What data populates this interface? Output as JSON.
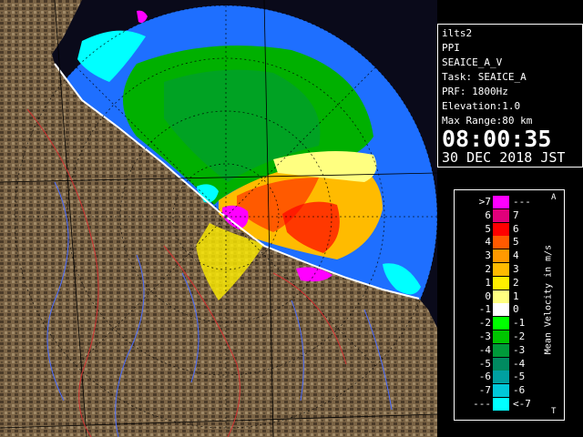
{
  "info": {
    "station": "ilts2",
    "product": "PPI",
    "product_name": "SEAICE_A_V",
    "task": "Task: SEAICE_A",
    "prf": "PRF: 1800Hz",
    "elevation": "Elevation:1.0",
    "max_range": "Max Range:80 km",
    "time": "08:00:35",
    "date": "30 DEC 2018 JST"
  },
  "legend": {
    "title": "Mean Velocity in m/s",
    "corner_top": "A",
    "corner_bottom": "T",
    "rows": [
      {
        "left": ">7",
        "right": "---",
        "color": "#ff00ff"
      },
      {
        "left": "6",
        "right": "7",
        "color": "#e0007a"
      },
      {
        "left": "5",
        "right": "6",
        "color": "#ff0000"
      },
      {
        "left": "4",
        "right": "5",
        "color": "#ff5a00"
      },
      {
        "left": "3",
        "right": "4",
        "color": "#ff9900"
      },
      {
        "left": "2",
        "right": "3",
        "color": "#ffbb00"
      },
      {
        "left": "1",
        "right": "2",
        "color": "#ffee00"
      },
      {
        "left": "0",
        "right": "1",
        "color": "#ffff80"
      },
      {
        "left": "-1",
        "right": "0",
        "color": "#ffffff"
      },
      {
        "left": "-2",
        "right": "-1",
        "color": "#00ff00"
      },
      {
        "left": "-3",
        "right": "-2",
        "color": "#00c400"
      },
      {
        "left": "-4",
        "right": "-3",
        "color": "#009a3a"
      },
      {
        "left": "-5",
        "right": "-4",
        "color": "#008a60"
      },
      {
        "left": "-6",
        "right": "-5",
        "color": "#00a0a0"
      },
      {
        "left": "-7",
        "right": "-6",
        "color": "#00c8d8"
      },
      {
        "left": "---",
        "right": "<-7",
        "color": "#00ffff"
      }
    ]
  },
  "colors": {
    "background": "#000000",
    "sea_blue": "#1e6fff",
    "land": "#7a6345",
    "panel_border": "#ffffff"
  }
}
